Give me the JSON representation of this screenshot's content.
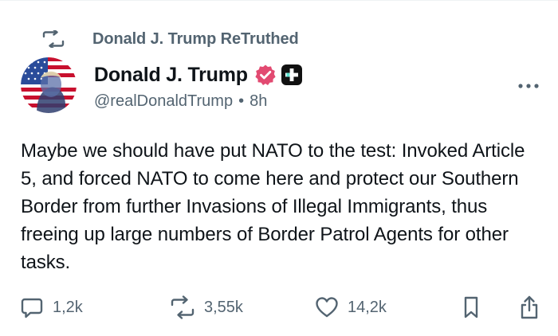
{
  "retruth": {
    "text": "Donald J. Trump ReTruthed"
  },
  "post": {
    "author_name": "Donald J. Trump",
    "handle": "@realDonaldTrump",
    "separator": "•",
    "time": "8h",
    "body": "Maybe we should have put NATO to the test: Invoked Article 5, and forced NATO to come here and protect our Southern Border from further Invasions of Illegal Immigrants, thus freeing up large numbers of Border Patrol Agents for other tasks."
  },
  "actions": {
    "replies": "1,2k",
    "retruths": "3,55k",
    "likes": "14,2k"
  },
  "icons": {
    "retruth": "retruth-icon",
    "verified": "verified-badge-icon",
    "app": "app-badge-icon",
    "more": "more-icon",
    "reply": "reply-icon",
    "like": "heart-icon",
    "bookmark": "bookmark-icon",
    "share": "share-icon"
  },
  "colors": {
    "verified": "#e24a71",
    "muted": "#536471",
    "text": "#0f1419"
  }
}
